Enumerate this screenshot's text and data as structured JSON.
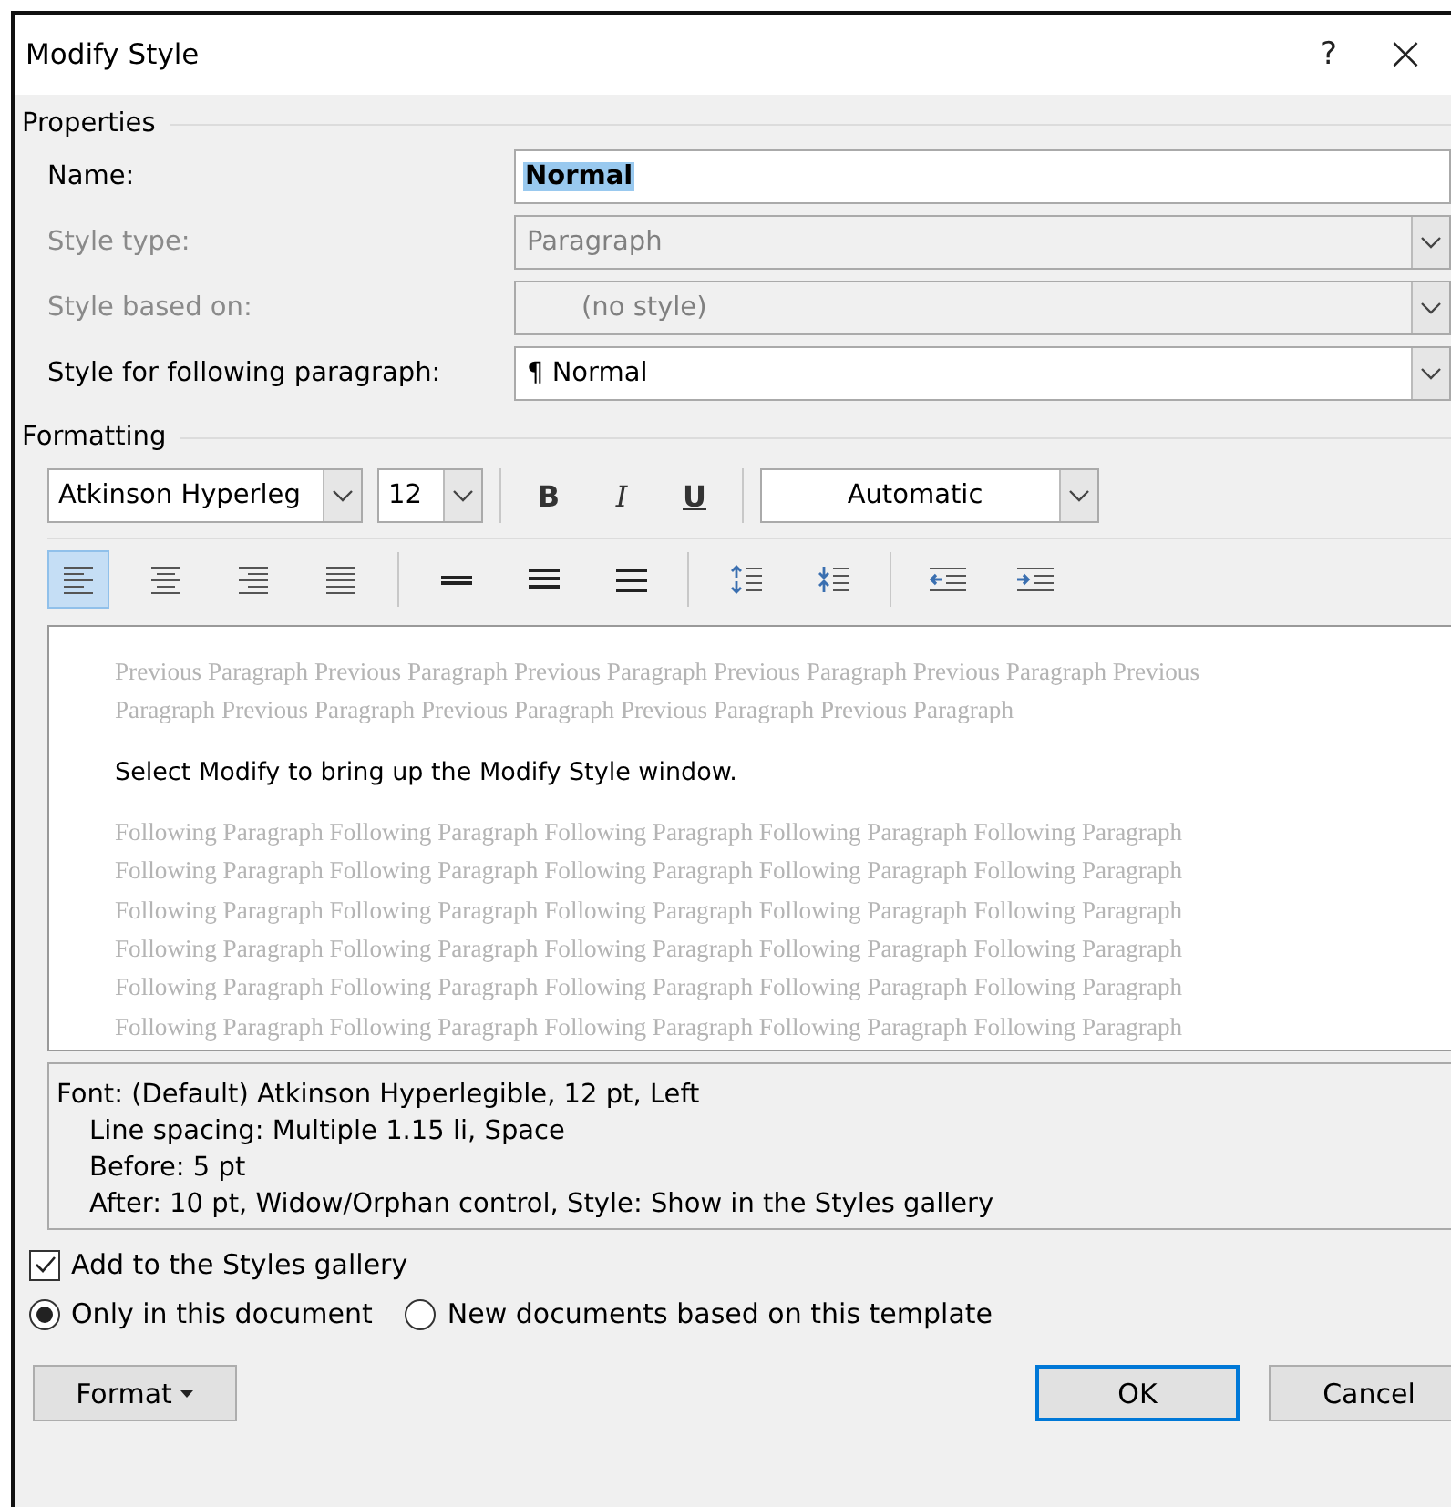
{
  "window": {
    "title": "Modify Style",
    "help": "?",
    "close": "×"
  },
  "properties": {
    "legend": "Properties",
    "fields": [
      {
        "label": "Name:",
        "kind": "text",
        "value": "Normal",
        "disabled": false
      },
      {
        "label": "Style type:",
        "kind": "dropdown",
        "value": "Paragraph",
        "disabled": true
      },
      {
        "label": "Style based on:",
        "kind": "dropdown",
        "value": "(no style)",
        "disabled": true
      },
      {
        "label": "Style for following paragraph:",
        "kind": "dropdown",
        "value": "¶ Normal",
        "disabled": false
      }
    ]
  },
  "formatting": {
    "legend": "Formatting",
    "font": "Atkinson Hyperleg",
    "size": "12",
    "bold": "B",
    "italic": "I",
    "underline": "U",
    "font_color": "Automatic",
    "tools": [
      {
        "kind": "align-left",
        "selected": true
      },
      {
        "kind": "align-center",
        "selected": false
      },
      {
        "kind": "align-right",
        "selected": false
      },
      {
        "kind": "justify",
        "selected": false
      },
      {
        "kind": "single-spacing",
        "selected": false
      },
      {
        "kind": "one-half-spacing",
        "selected": false
      },
      {
        "kind": "double-spacing",
        "selected": false
      },
      {
        "kind": "increase-spacing",
        "selected": false
      },
      {
        "kind": "decrease-spacing",
        "selected": false
      },
      {
        "kind": "decrease-indent",
        "selected": false
      },
      {
        "kind": "increase-indent",
        "selected": false
      }
    ]
  },
  "preview": {
    "previous": [
      "Previous Paragraph Previous Paragraph Previous Paragraph Previous Paragraph Previous Paragraph Previous",
      "Paragraph Previous Paragraph Previous Paragraph Previous Paragraph Previous Paragraph"
    ],
    "sample": "Select Modify to bring up the Modify Style window.",
    "following": [
      "Following Paragraph Following Paragraph Following Paragraph Following Paragraph Following Paragraph",
      "Following Paragraph Following Paragraph Following Paragraph Following Paragraph Following Paragraph",
      "Following Paragraph Following Paragraph Following Paragraph Following Paragraph Following Paragraph",
      "Following Paragraph Following Paragraph Following Paragraph Following Paragraph Following Paragraph",
      "Following Paragraph Following Paragraph Following Paragraph Following Paragraph Following Paragraph",
      "Following Paragraph Following Paragraph Following Paragraph Following Paragraph Following Paragraph"
    ]
  },
  "description": [
    "Font: (Default) Atkinson Hyperlegible, 12 pt, Left",
    "Line spacing:  Multiple 1.15 li, Space",
    "Before:  5 pt",
    "After:  10 pt, Widow/Orphan control, Style: Show in the Styles gallery"
  ],
  "add_to_gallery": {
    "label": "Add to the Styles gallery",
    "checked": true
  },
  "scope": [
    {
      "label": "Only in this document",
      "selected": true
    },
    {
      "label": "New documents based on this template",
      "selected": false
    }
  ],
  "buttons": {
    "format": "Format",
    "ok": "OK",
    "cancel": "Cancel"
  }
}
